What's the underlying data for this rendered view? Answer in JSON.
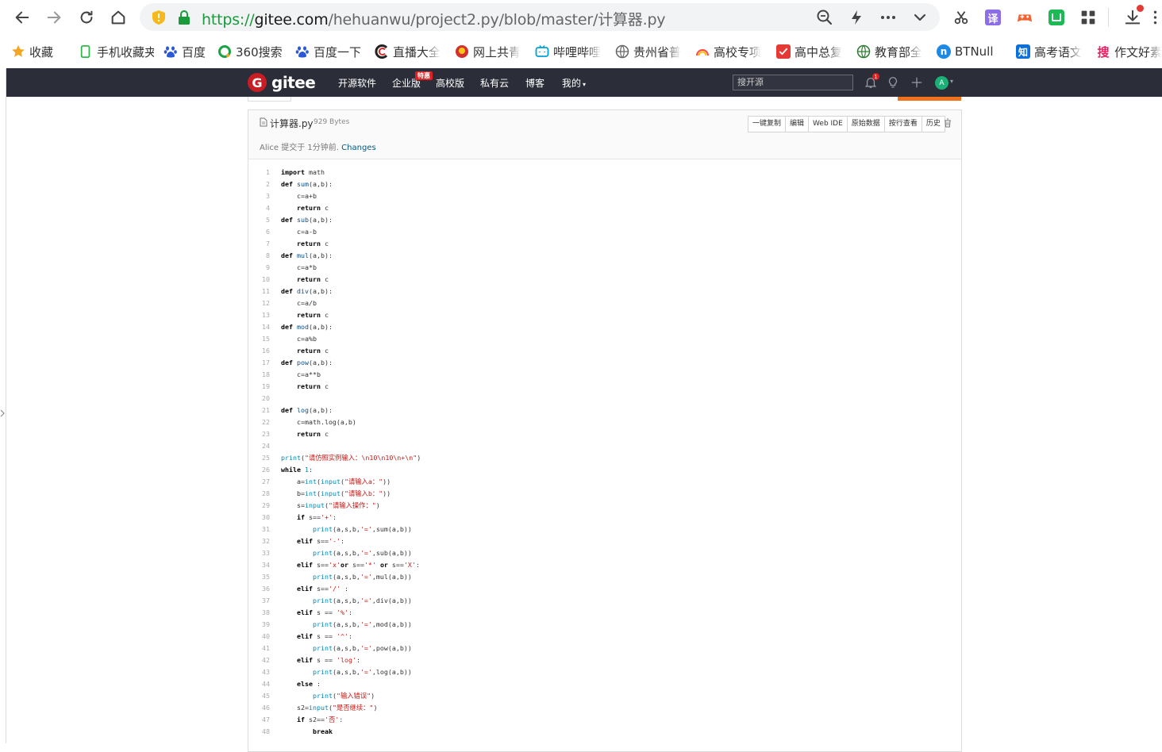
{
  "browser": {
    "url_proto": "https://",
    "url_host": "gitee.com",
    "url_path": "/hehuanwu/project2.py/blob/master/计算器.py"
  },
  "bookmarks": [
    {
      "label": "收藏",
      "icon": "star-icon",
      "color": "#f5a623"
    },
    {
      "label": "手机收藏夹",
      "icon": "phone-icon",
      "color": "#2db84d"
    },
    {
      "label": "百度",
      "icon": "baidu-paw-icon",
      "color": "#2b59d6"
    },
    {
      "label": "360搜索",
      "icon": "360-icon",
      "color": "#1aa345"
    },
    {
      "label": "百度一下",
      "icon": "baidu-paw-icon",
      "color": "#2b59d6"
    },
    {
      "label": "直播大全",
      "icon": "c-logo-icon",
      "color": "#222222"
    },
    {
      "label": "网上共青",
      "icon": "emblem-icon",
      "color": "#d32f2f"
    },
    {
      "label": "哔哩哔哩",
      "icon": "tv-icon",
      "color": "#00a1d6"
    },
    {
      "label": "贵州省普",
      "icon": "globe-icon",
      "color": "#666666"
    },
    {
      "label": "高校专项",
      "icon": "rainbow-icon",
      "color": "#f0a020"
    },
    {
      "label": "高中总复",
      "icon": "check-icon",
      "color": "#e53935"
    },
    {
      "label": "教育部全",
      "icon": "earth-icon",
      "color": "#2e7d32"
    },
    {
      "label": "BTNull",
      "icon": "n-icon",
      "color": "#1e88e5"
    },
    {
      "label": "高考语文",
      "icon": "zhi-icon",
      "color": "#0f6fd8"
    },
    {
      "label": "作文好素",
      "icon": "sou-icon",
      "color": "#e91e63"
    }
  ],
  "gitee": {
    "logo_badge": "G",
    "logo_text": "gitee",
    "nav": [
      "开源软件",
      "企业版",
      "高校版",
      "私有云",
      "博客",
      "我的"
    ],
    "hot_badge": "特惠",
    "search_placeholder": "搜开源",
    "notif_count": "1",
    "avatar_letter": "A"
  },
  "file": {
    "name": "计算器.py",
    "size": "929 Bytes",
    "commit_author": "Alice",
    "commit_text": "提交于 1分钟前",
    "commit_link": "Changes",
    "actions": [
      "一键复制",
      "编辑",
      "Web IDE",
      "原始数据",
      "按行查看",
      "历史"
    ]
  },
  "code_lines": [
    "import math",
    "def sum(a,b):",
    "    c=a+b",
    "    return c",
    "def sub(a,b):",
    "    c=a-b",
    "    return c",
    "def mul(a,b):",
    "    c=a*b",
    "    return c",
    "def div(a,b):",
    "    c=a/b",
    "    return c",
    "def mod(a,b):",
    "    c=a%b",
    "    return c",
    "def pow(a,b):",
    "    c=a**b",
    "    return c",
    "",
    "def log(a,b):",
    "    c=math.log(a,b)",
    "    return c",
    "",
    "print(\"请仿照实例输入：\\n10\\n10\\n+\\n\")",
    "while 1:",
    "    a=int(input(\"请输入a：\"))",
    "    b=int(input(\"请输入b：\"))",
    "    s=input(\"请输入操作：\")",
    "    if s=='+':",
    "        print(a,s,b,'=',sum(a,b))",
    "    elif s=='-':",
    "        print(a,s,b,'=',sub(a,b))",
    "    elif s=='x'or s=='*' or s=='X':",
    "        print(a,s,b,'=',mul(a,b))",
    "    elif s=='/' :",
    "        print(a,s,b,'=',div(a,b))",
    "    elif s == '%':",
    "        print(a,s,b,'=',mod(a,b))",
    "    elif s == '^':",
    "        print(a,s,b,'=',pow(a,b))",
    "    elif s == 'log':",
    "        print(a,s,b,'=',log(a,b))",
    "    else :",
    "        print(\"输入错误\")",
    "    s2=input(\"是否继续：\")",
    "    if s2=='否':",
    "        break"
  ]
}
